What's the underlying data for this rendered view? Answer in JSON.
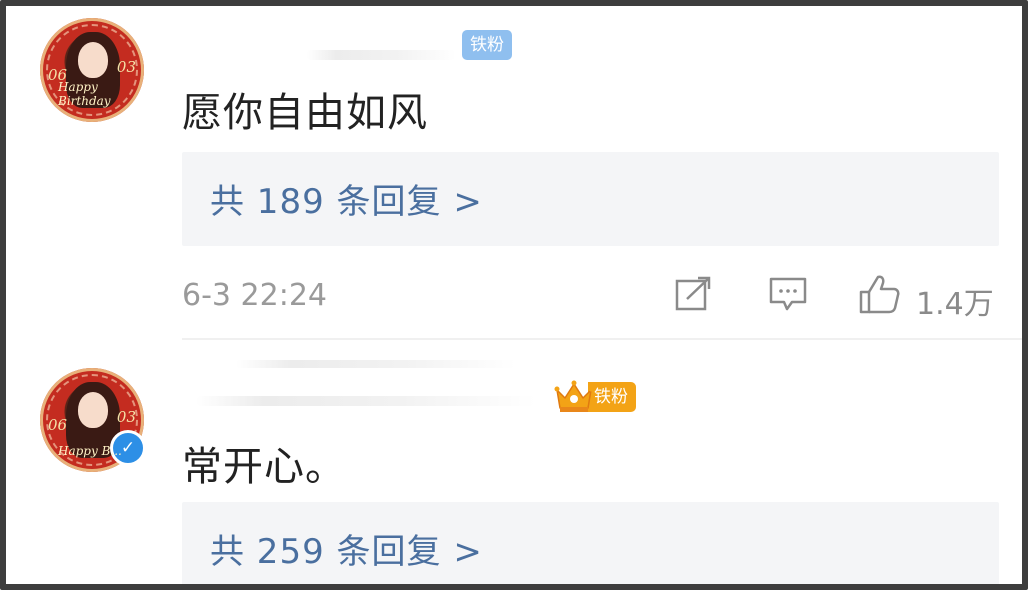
{
  "comments": [
    {
      "badge": "铁粉",
      "text": "愿你自由如风",
      "replies": "共 189 条回复 >",
      "time": "6-3 22:24",
      "likes": "1.4万",
      "avatar": {
        "left_text": "06",
        "right_text": "03",
        "script": "Happy Birthday"
      }
    },
    {
      "badge": "铁粉",
      "text": "常开心。",
      "replies": "共 259 条回复 >",
      "avatar": {
        "left_text": "06",
        "right_text": "03",
        "script": "Happy B..."
      },
      "verified_mark": "✓"
    }
  ],
  "icons": {
    "share": "share-icon",
    "comment": "comment-icon",
    "like": "thumbs-up-icon",
    "crown": "crown-icon",
    "verified": "verified-icon"
  },
  "colors": {
    "reply_link": "#4a6f9f",
    "fan_badge": "#8fbfef",
    "crown_badge": "#f3a316",
    "verified": "#2d8fe6"
  }
}
